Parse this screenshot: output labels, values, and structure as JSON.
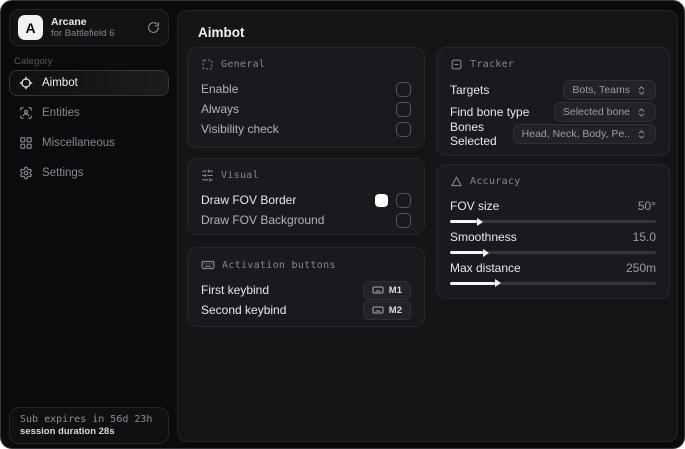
{
  "colors": {
    "window_bg": "#0b0b0d",
    "main_bg": "#151518",
    "panel_bg": "#1a1a1e",
    "panel_border": "#26262b",
    "text_bright": "#e8e8ea",
    "text_muted": "#85858d",
    "fov_border_swatch": "#ffffff"
  },
  "sidebar": {
    "logo": {
      "initial": "A",
      "title": "Arcane",
      "subtitle": "for Battlefield 6",
      "icon": "refresh-icon"
    },
    "category_label": "Category",
    "items": [
      {
        "label": "Aimbot",
        "icon": "crosshair-icon",
        "active": true
      },
      {
        "label": "Entities",
        "icon": "entities-icon",
        "active": false
      },
      {
        "label": "Miscellaneous",
        "icon": "grid-icon",
        "active": false
      },
      {
        "label": "Settings",
        "icon": "gear-icon",
        "active": false
      }
    ],
    "footer": {
      "expiry": "Sub expires in 56d 23h",
      "session": "session duration 28s"
    }
  },
  "main": {
    "title": "Aimbot",
    "general": {
      "title": "General",
      "icon": "dashed-square-icon",
      "rows": [
        {
          "label": "Enable",
          "checked": false
        },
        {
          "label": "Always",
          "checked": false
        },
        {
          "label": "Visibility check",
          "checked": false
        }
      ]
    },
    "visual": {
      "title": "Visual",
      "icon": "sliders-icon",
      "rows": [
        {
          "label": "Draw FOV Border",
          "checked": false,
          "swatch": "#ffffff"
        },
        {
          "label": "Draw FOV Background",
          "checked": false
        }
      ]
    },
    "activation": {
      "title": "Activation buttons",
      "icon": "keyboard-icon",
      "rows": [
        {
          "label": "First keybind",
          "key": "M1"
        },
        {
          "label": "Second keybind",
          "key": "M2"
        }
      ]
    },
    "tracker": {
      "title": "Tracker",
      "icon": "square-minus-icon",
      "rows": [
        {
          "label": "Targets",
          "value": "Bots, Teams"
        },
        {
          "label": "Find bone type",
          "value": "Selected bone"
        },
        {
          "label": "Bones Selected",
          "value": "Head, Neck, Body, Pe.."
        }
      ]
    },
    "accuracy": {
      "title": "Accuracy",
      "icon": "triangle-icon",
      "sliders": [
        {
          "label": "FOV size",
          "value": "50°",
          "fill_percent": 13
        },
        {
          "label": "Smoothness",
          "value": "15.0",
          "fill_percent": 16
        },
        {
          "label": "Max distance",
          "value": "250m",
          "fill_percent": 22
        }
      ]
    }
  }
}
